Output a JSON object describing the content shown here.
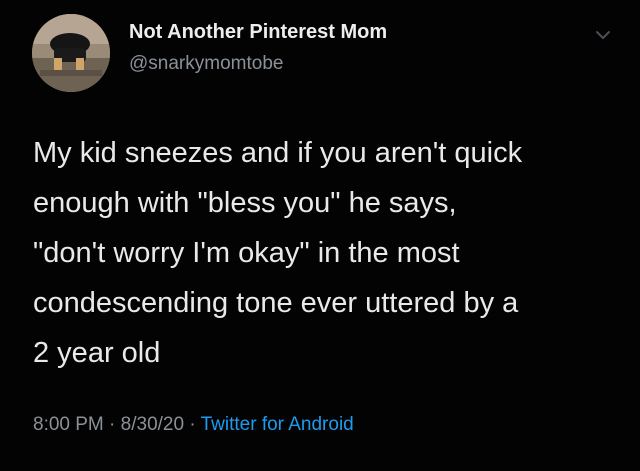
{
  "author": {
    "display_name": "Not Another Pinterest Mom",
    "handle": "@snarkymomtobe",
    "avatar_icon": "profile-photo"
  },
  "menu_icon": "chevron-down-icon",
  "tweet": {
    "text": "My kid sneezes and if you aren't quick\nenough with \"bless you\" he says,\n\"don't worry I'm okay\" in the most\ncondescending tone ever uttered by a\n2 year old",
    "time": "8:00 PM",
    "separator": " · ",
    "date": "8/30/20",
    "source": "Twitter for Android"
  },
  "colors": {
    "background": "#030303",
    "text": "#e9e9e9",
    "secondary": "#8b9197",
    "link": "#1d9bf0"
  }
}
